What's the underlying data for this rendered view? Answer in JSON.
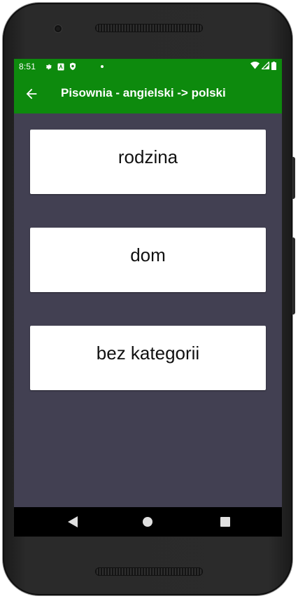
{
  "status_bar": {
    "time": "8:51",
    "icons": [
      "settings-icon",
      "sim-icon",
      "shield-icon",
      "dot-icon"
    ],
    "right_icons": [
      "wifi-icon",
      "signal-icon",
      "battery-icon"
    ]
  },
  "app_bar": {
    "title": "Pisownia - angielski -> polski",
    "back_icon": "arrow-left-icon"
  },
  "categories": [
    {
      "label": "rodzina"
    },
    {
      "label": "dom"
    },
    {
      "label": "bez kategorii"
    }
  ],
  "nav_bar": {
    "buttons": [
      "back-triangle-icon",
      "home-circle-icon",
      "recents-square-icon"
    ]
  },
  "colors": {
    "accent": "#0d8a0d",
    "background": "#424052",
    "card": "#ffffff",
    "nav": "#000000"
  }
}
